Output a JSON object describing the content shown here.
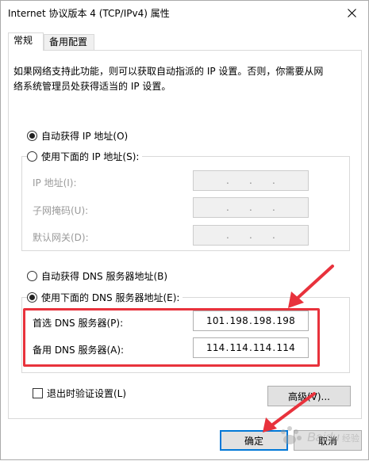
{
  "window": {
    "title": "Internet 协议版本 4 (TCP/IPv4) 属性",
    "close_icon": "close-icon"
  },
  "tabs": [
    {
      "label": "常规",
      "active": true
    },
    {
      "label": "备用配置",
      "active": false
    }
  ],
  "description": {
    "line1": "如果网络支持此功能，则可以获取自动指派的 IP 设置。否则，你需要从网",
    "line2": "络系统管理员处获得适当的 IP 设置。"
  },
  "ip_section": {
    "auto_label": "自动获得 IP 地址(O)",
    "auto_selected": true,
    "manual_label": "使用下面的 IP 地址(S):",
    "manual_selected": false,
    "fields": [
      {
        "label": "IP 地址(I):",
        "value": ""
      },
      {
        "label": "子网掩码(U):",
        "value": ""
      },
      {
        "label": "默认网关(D):",
        "value": ""
      }
    ]
  },
  "dns_section": {
    "auto_label": "自动获得 DNS 服务器地址(B)",
    "auto_selected": false,
    "manual_label": "使用下面的 DNS 服务器地址(E):",
    "manual_selected": true,
    "preferred": {
      "label": "首选 DNS 服务器(P):",
      "octets": [
        "101",
        "198",
        "198",
        "198"
      ]
    },
    "alternate": {
      "label": "备用 DNS 服务器(A):",
      "octets": [
        "114",
        "114",
        "114",
        "114"
      ]
    }
  },
  "validate": {
    "label": "退出时验证设置(L)",
    "checked": false
  },
  "buttons": {
    "advanced": "高级(V)...",
    "ok": "确定",
    "cancel": "取消"
  },
  "colors": {
    "highlight": "#e8323c",
    "accent": "#0078d7"
  },
  "watermark": "Baidu 经验"
}
